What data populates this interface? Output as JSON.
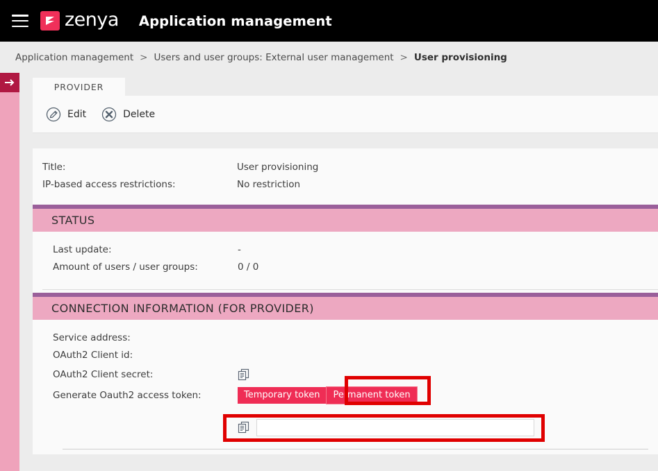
{
  "topbar": {
    "menu_icon": "hamburger-icon",
    "logo_letter": "Z",
    "logo_text": "zenya",
    "title": "Application management",
    "bg_color": "#000000",
    "logo_color": "#f0305a"
  },
  "breadcrumb": {
    "items": [
      {
        "label": "Application management",
        "current": false
      },
      {
        "label": "Users and user groups: External user management",
        "current": false
      },
      {
        "label": "User provisioning",
        "current": true
      }
    ],
    "separator": ">"
  },
  "rail": {
    "toggle_icon": "arrow-right-icon",
    "toggle_color": "#b01842",
    "rail_color": "#efa3bb"
  },
  "tabs": [
    {
      "label": "PROVIDER",
      "active": true
    }
  ],
  "toolbar": {
    "edit_label": "Edit",
    "edit_icon": "pencil-circle-icon",
    "delete_label": "Delete",
    "delete_icon": "x-circle-icon"
  },
  "details": {
    "rows": [
      {
        "key": "Title:",
        "value": "User provisioning"
      },
      {
        "key": "IP-based access restrictions:",
        "value": "No restriction"
      }
    ]
  },
  "status_section": {
    "heading": "STATUS",
    "accent_color": "#9a5f9a",
    "header_bg": "#eda8c1",
    "rows": [
      {
        "key": "Last update:",
        "value": "-"
      },
      {
        "key": "Amount of users / user groups:",
        "value": "0 / 0"
      }
    ]
  },
  "connection_section": {
    "heading": "CONNECTION INFORMATION (FOR PROVIDER)",
    "accent_color": "#9a5f9a",
    "header_bg": "#eda8c1",
    "rows": [
      {
        "key": "Service address:",
        "value": ""
      },
      {
        "key": "OAuth2 Client id:",
        "value": ""
      }
    ],
    "secret_key": "OAuth2 Client secret:",
    "secret_copy_icon": "copy-icon",
    "token_key": "Generate Oauth2 access token:",
    "temporary_token_label": "Temporary token",
    "permanent_token_label": "Permanent token",
    "token_button_color": "#ef2d55",
    "token_copy_icon": "copy-icon",
    "token_value": "",
    "token_placeholder": "",
    "highlight_color": "#e00000"
  }
}
